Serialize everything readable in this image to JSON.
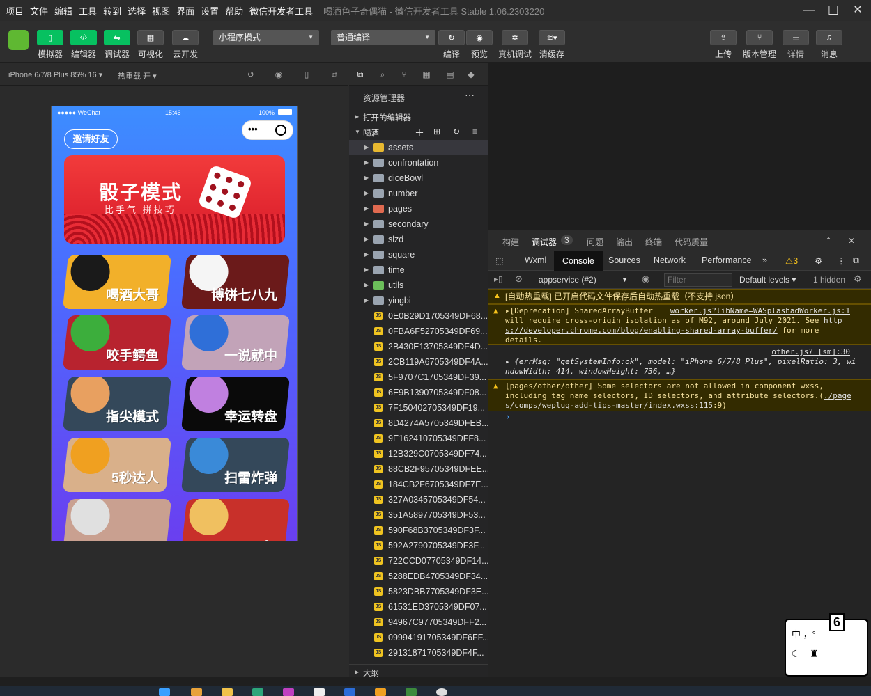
{
  "menubar": {
    "items": [
      "项目",
      "文件",
      "编辑",
      "工具",
      "转到",
      "选择",
      "视图",
      "界面",
      "设置",
      "帮助",
      "微信开发者工具"
    ],
    "window_title": "喝酒色子奇偶猫 - 微信开发者工具 Stable 1.06.2303220"
  },
  "toolbar": {
    "simulator": "模拟器",
    "editor": "编辑器",
    "debugger": "调试器",
    "visual": "可视化",
    "cloud": "云开发",
    "mode_select": "小程序模式",
    "compile_select": "普通编译",
    "compile": "编译",
    "preview": "预览",
    "device_debug": "真机调试",
    "clear_cache": "清缓存",
    "upload": "上传",
    "version": "版本管理",
    "details": "详情",
    "messages": "消息"
  },
  "simbar": {
    "device": "iPhone 6/7/8 Plus 85% 16 ▾",
    "hot_reload": "热重载 开 ▾"
  },
  "phone": {
    "carrier": "●●●●● WeChat",
    "time": "15:46",
    "battery": "100%",
    "invite": "邀请好友",
    "banner_title": "骰子模式",
    "banner_sub": "比手气 拼技巧",
    "cards": [
      "喝酒大哥",
      "博饼七八九",
      "咬手鳄鱼",
      "一说就中",
      "指尖模式",
      "幸运转盘",
      "5秒达人",
      "扫雷炸弹",
      "",
      "。"
    ]
  },
  "explorer": {
    "title": "资源管理器",
    "open_editors": "打开的编辑器",
    "project": "喝酒",
    "outline": "大纲",
    "folders": [
      "assets",
      "confrontation",
      "diceBowl",
      "number",
      "pages",
      "secondary",
      "slzd",
      "square",
      "time",
      "utils",
      "yingbi"
    ],
    "files": [
      "0E0B29D1705349DF68...",
      "0FBA6F52705349DF69...",
      "2B430E13705349DF4D...",
      "2CB119A6705349DF4A...",
      "5F9707C1705349DF39...",
      "6E9B1390705349DF08...",
      "7F150402705349DF19...",
      "8D4274A5705349DFEB...",
      "9E162410705349DFF8...",
      "12B329C0705349DF74...",
      "88CB2F95705349DFEE...",
      "184CB2F6705349DF7E...",
      "327A0345705349DF54...",
      "351A5897705349DF53...",
      "590F68B3705349DF3F...",
      "592A2790705349DF3F...",
      "722CCD07705349DF14...",
      "5288EDB4705349DF34...",
      "5823DBB7705349DF3E...",
      "61531ED3705349DF07...",
      "94967C97705349DFF2...",
      "09994191705349DF6FF...",
      "29131871705349DF4F..."
    ]
  },
  "devtools": {
    "top_tabs": [
      "构建",
      "调试器",
      "3",
      "问题",
      "输出",
      "终端",
      "代码质量"
    ],
    "tabs": [
      "Wxml",
      "Console",
      "Sources",
      "Network",
      "Performance",
      "»",
      "⚠3"
    ],
    "context": "appservice (#2)",
    "filter_placeholder": "Filter",
    "levels": "Default levels ▾",
    "hidden": "1 hidden",
    "logs": [
      {
        "type": "warn",
        "text": "[自动热重载] 已开启代码文件保存后自动热重载（不支持 json）"
      },
      {
        "type": "warn",
        "text": "▸[Deprecation] SharedArrayBuffer",
        "link": "worker.js?libName=WASplashadWorker.js:1",
        "text2": "will require cross-origin isolation as of M92, around July 2021. See",
        "link2": "http",
        "link3": "s://developer.chrome.com/blog/enabling-shared-array-buffer/",
        "text3": "for more",
        "text4": "details."
      },
      {
        "type": "log",
        "link": "other.js? [sm]:30",
        "text": "▸ {errMsg: \"getSystemInfo:ok\", model: \"iPhone 6/7/8 Plus\", pixelRatio: 3, wi",
        "text2": "ndowWidth: 414, windowHeight: 736, …}"
      },
      {
        "type": "warn",
        "text": "[pages/other/other] Some selectors are not allowed in component wxss,",
        "text2": "including tag name selectors, ID selectors, and attribute selectors.(",
        "link": "./page",
        "link2": "s/comps/weplug-add-tips-master/index.wxss:115",
        "text3": ":9)"
      }
    ],
    "prompt": "›"
  },
  "ime": {
    "label": "中 ，°",
    "badge": "6"
  }
}
